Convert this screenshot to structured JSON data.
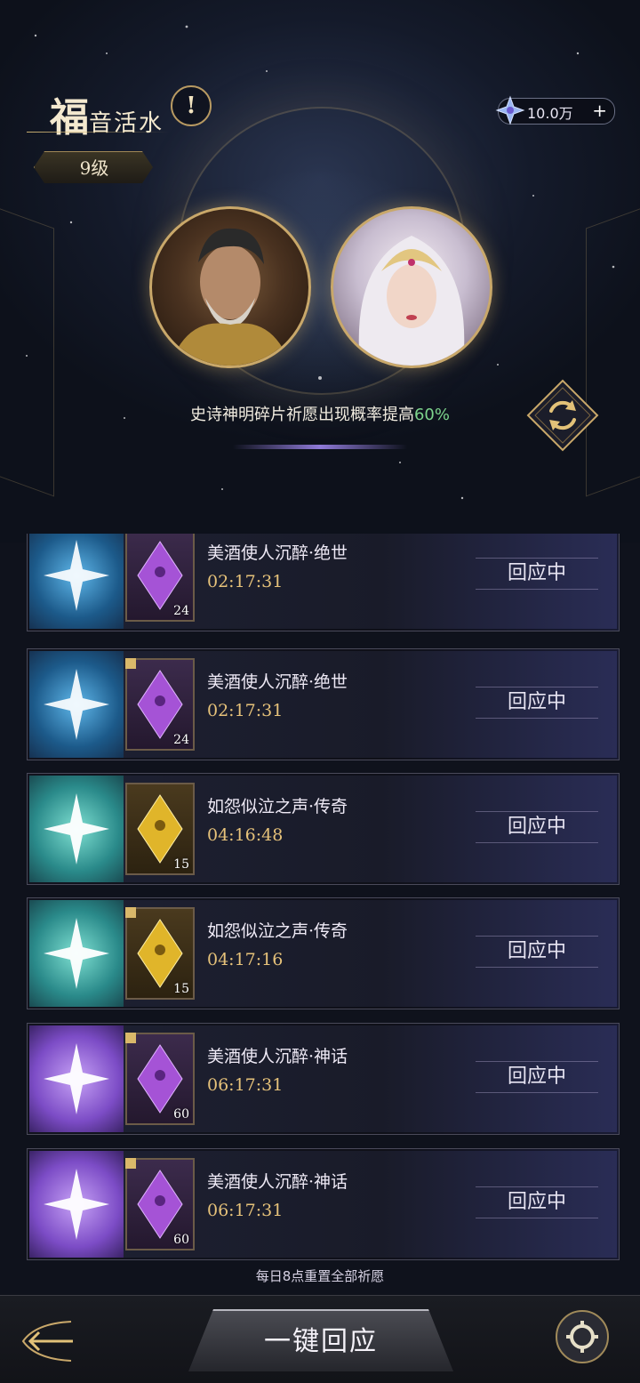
{
  "header": {
    "title_big": "福",
    "title_rest": "音活水",
    "info_symbol": "!",
    "level": "9级",
    "currency": {
      "icon": "star-gem-icon",
      "amount": "10.0万",
      "plus": "+"
    }
  },
  "banner": {
    "boost_prefix": "史诗神明碎片祈愿出现概率提高",
    "boost_value": "60%",
    "portraits": [
      "bearded-god-portrait",
      "white-haired-goddess-portrait"
    ]
  },
  "wishes": [
    {
      "name": "美酒使人沉醉·绝世",
      "timer": "02:17:31",
      "status": "回应中",
      "count": "24",
      "star_color": "blue",
      "card_color": "purple"
    },
    {
      "name": "美酒使人沉醉·绝世",
      "timer": "02:17:31",
      "status": "回应中",
      "count": "24",
      "star_color": "blue",
      "card_color": "purple"
    },
    {
      "name": "如怨似泣之声·传奇",
      "timer": "04:16:48",
      "status": "回应中",
      "count": "15",
      "star_color": "teal",
      "card_color": "gold"
    },
    {
      "name": "如怨似泣之声·传奇",
      "timer": "04:17:16",
      "status": "回应中",
      "count": "15",
      "star_color": "teal",
      "card_color": "gold"
    },
    {
      "name": "美酒使人沉醉·神话",
      "timer": "06:17:31",
      "status": "回应中",
      "count": "60",
      "star_color": "purple",
      "card_color": "purple"
    },
    {
      "name": "美酒使人沉醉·神话",
      "timer": "06:17:31",
      "status": "回应中",
      "count": "60",
      "star_color": "purple",
      "card_color": "purple"
    }
  ],
  "footer": {
    "reset_note": "每日8点重置全部祈愿",
    "respond_all": "一键回应"
  },
  "colors": {
    "accent_gold": "#c9a86a",
    "timer": "#e6c27a",
    "boost_green": "#7dd48c"
  }
}
